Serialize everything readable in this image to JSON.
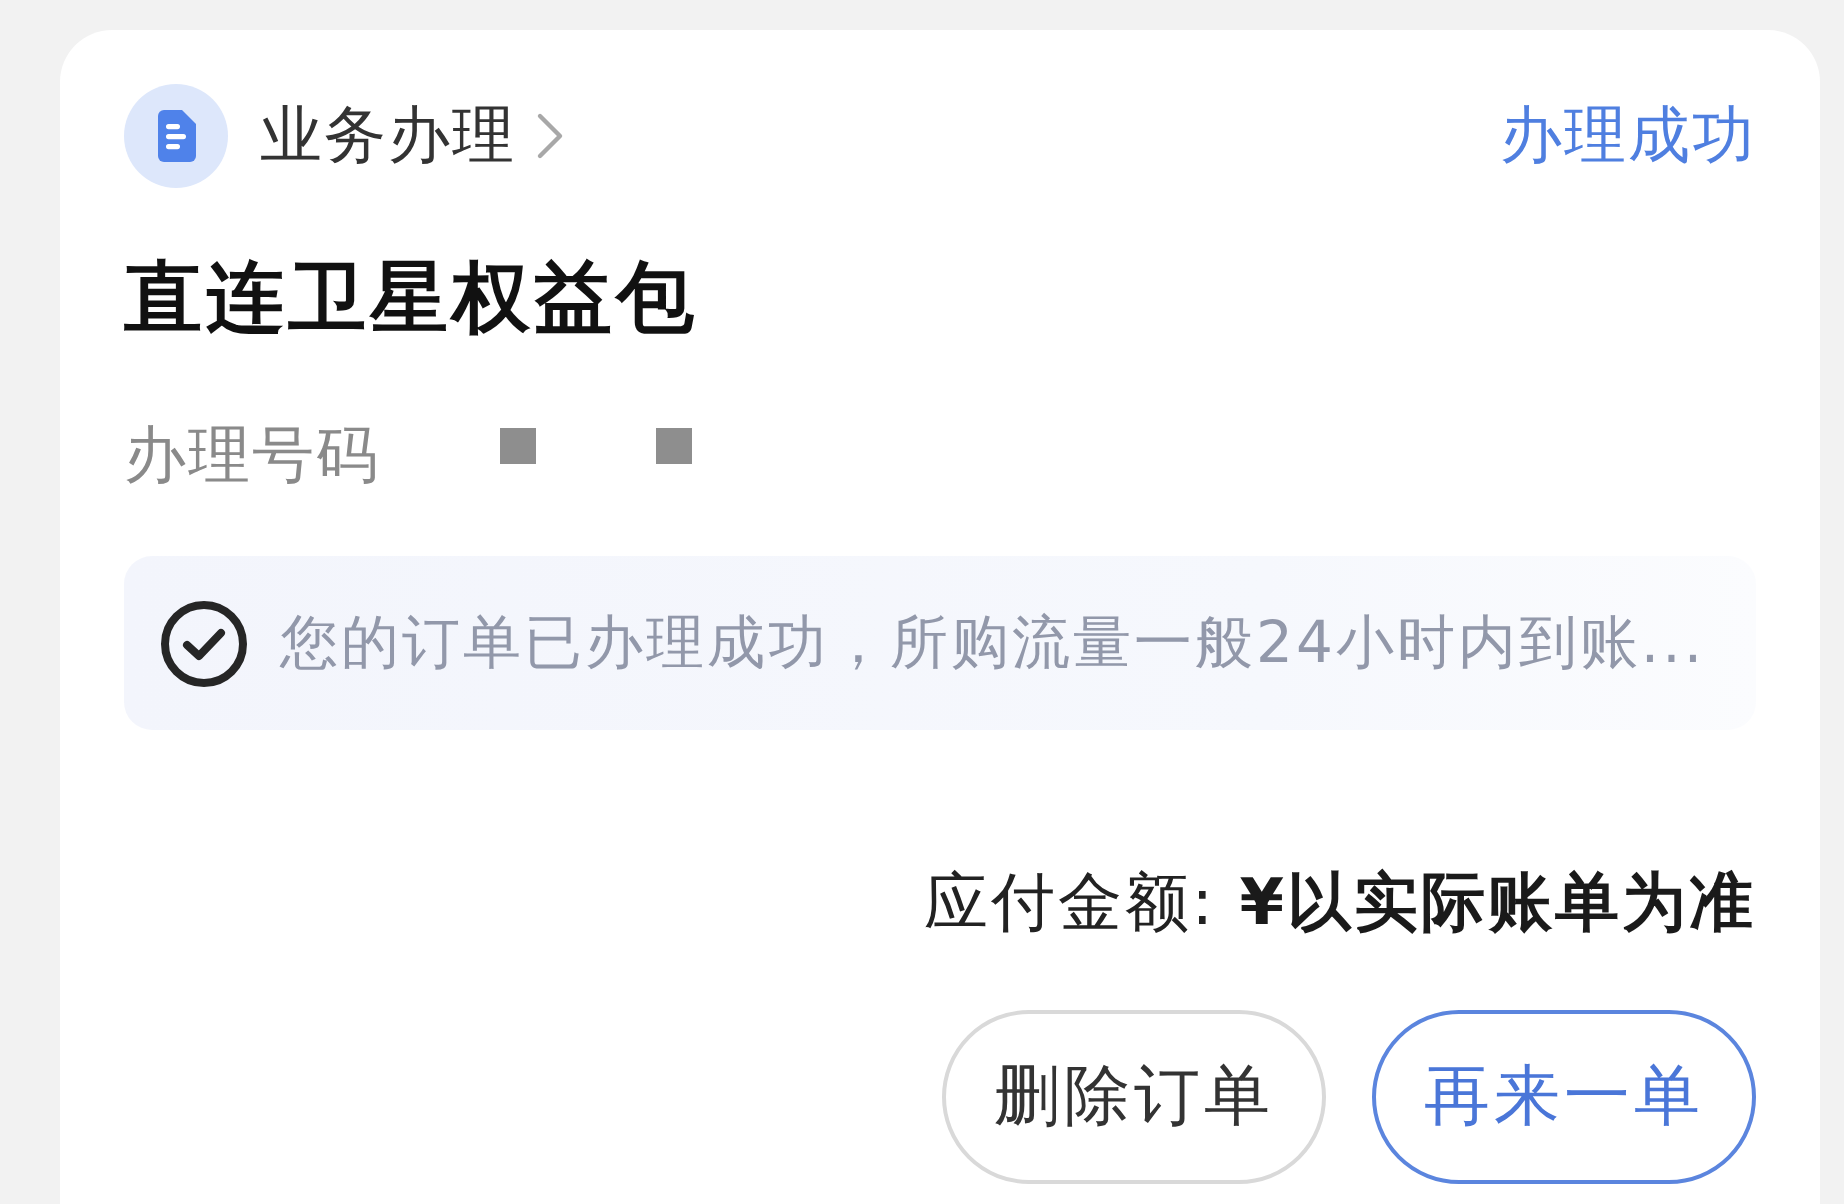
{
  "header": {
    "category": "业务办理",
    "status": "办理成功"
  },
  "title": "直连卫星权益包",
  "number": {
    "label": "办理号码"
  },
  "notice": {
    "text": "您的订单已办理成功，所购流量一般24小时内到账..."
  },
  "amount": {
    "text": "应付金额: **¥以实际账单为准**"
  },
  "buttons": [
    {
      "label": "删除订单",
      "kind": "secondary"
    },
    {
      "label": "再来一单",
      "kind": "primary"
    }
  ]
}
